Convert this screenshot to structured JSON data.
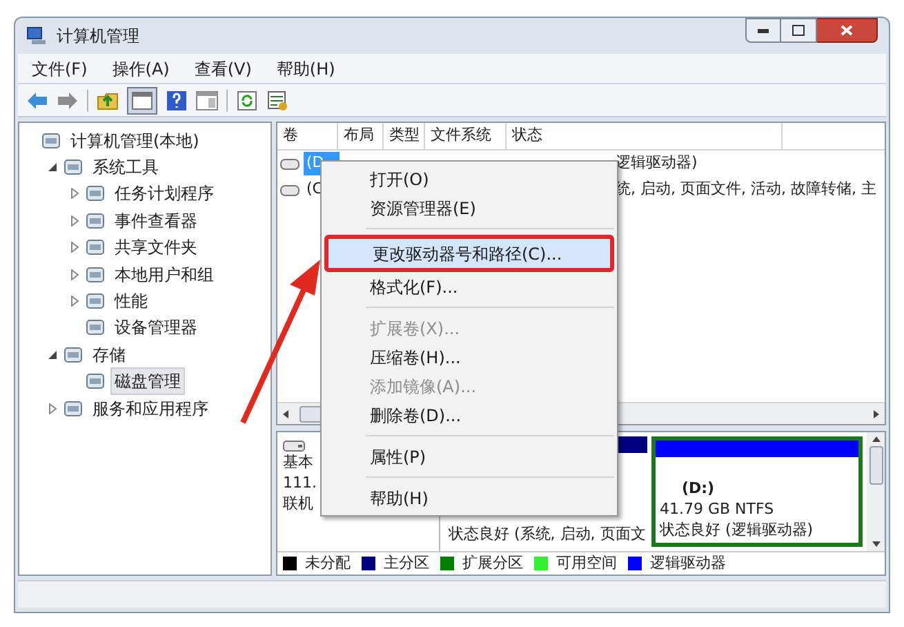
{
  "window": {
    "title": "计算机管理"
  },
  "menu_bar": [
    "文件(F)",
    "操作(A)",
    "查看(V)",
    "帮助(H)"
  ],
  "tree": [
    {
      "label": "计算机管理(本地)",
      "selected": false,
      "children": [
        {
          "label": "系统工具",
          "expanded": true,
          "selected": false,
          "children": [
            {
              "label": "任务计划程序",
              "expanded": false,
              "selected": false
            },
            {
              "label": "事件查看器",
              "expanded": false,
              "selected": false
            },
            {
              "label": "共享文件夹",
              "expanded": false,
              "selected": false
            },
            {
              "label": "本地用户和组",
              "expanded": false,
              "selected": false
            },
            {
              "label": "性能",
              "expanded": false,
              "selected": false
            },
            {
              "label": "设备管理器",
              "selected": false
            }
          ]
        },
        {
          "label": "存储",
          "expanded": true,
          "selected": false,
          "children": [
            {
              "label": "磁盘管理",
              "selected": true
            }
          ]
        },
        {
          "label": "服务和应用程序",
          "expanded": false,
          "selected": false
        }
      ]
    }
  ],
  "volume_table": {
    "columns": [
      "卷",
      "布局",
      "类型",
      "文件系统",
      "状态"
    ],
    "rows": [
      {
        "volume": "(D",
        "status": "逻辑驱动器)",
        "selected": true
      },
      {
        "volume": "(C",
        "status": "统, 启动, 页面文件, 活动, 故障转储, 主",
        "selected": false
      }
    ]
  },
  "disk": {
    "label_lines": [
      "基本",
      "111.",
      "联机"
    ],
    "partitions": [
      {
        "lines": [
          "状态良好 (系统, 启动, 页面文"
        ],
        "color": "#000080",
        "selected": false
      },
      {
        "name": "(D:)",
        "lines": [
          "41.79 GB NTFS",
          "状态良好 (逻辑驱动器)"
        ],
        "color": "#0000ff",
        "selected": true
      }
    ]
  },
  "legend": [
    {
      "label": "未分配",
      "color": "#000000"
    },
    {
      "label": "主分区",
      "color": "#000080"
    },
    {
      "label": "扩展分区",
      "color": "#008000"
    },
    {
      "label": "可用空间",
      "color": "#33ee33"
    },
    {
      "label": "逻辑驱动器",
      "color": "#0000ff"
    }
  ],
  "context_menu": {
    "groups": [
      [
        {
          "label": "打开(O)",
          "disabled": false,
          "selected": false
        },
        {
          "label": "资源管理器(E)",
          "disabled": false,
          "selected": false
        }
      ],
      [
        {
          "label": "更改驱动器号和路径(C)...",
          "disabled": false,
          "selected": true,
          "annotated": true
        },
        {
          "label": "格式化(F)...",
          "disabled": false,
          "selected": false
        }
      ],
      [
        {
          "label": "扩展卷(X)...",
          "disabled": true,
          "selected": false
        },
        {
          "label": "压缩卷(H)...",
          "disabled": false,
          "selected": false
        },
        {
          "label": "添加镜像(A)...",
          "disabled": true,
          "selected": false
        },
        {
          "label": "删除卷(D)...",
          "disabled": false,
          "selected": false
        }
      ],
      [
        {
          "label": "属性(P)",
          "disabled": false,
          "selected": false
        }
      ],
      [
        {
          "label": "帮助(H)",
          "disabled": false,
          "selected": false
        }
      ]
    ]
  }
}
